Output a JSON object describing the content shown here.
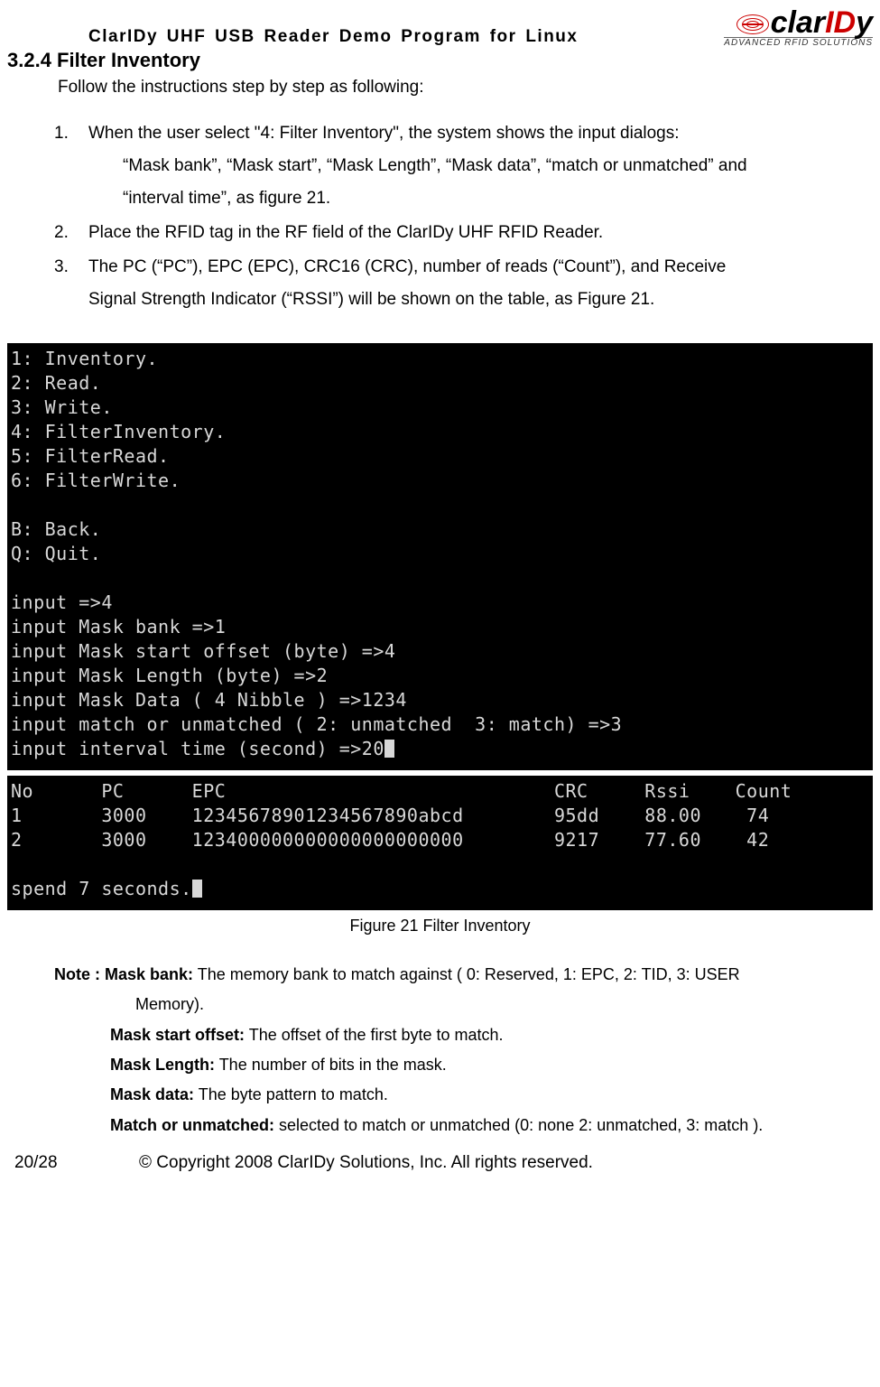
{
  "header": {
    "doc_title": "ClarIDy UHF USB Reader Demo Program for Linux",
    "logo_clar": "clar",
    "logo_id": "ID",
    "logo_y": "y",
    "logo_sub": "ADVANCED RFID SOLUTIONS"
  },
  "section": {
    "heading": "3.2.4 Filter Inventory",
    "intro": "Follow the instructions step by step as following:"
  },
  "steps": {
    "s1_num": "1.",
    "s1_line1": "When the user select \"4: Filter Inventory\", the system shows the input dialogs:",
    "s1_line2": "“Mask bank”, “Mask start”, “Mask Length”, “Mask data”, “match or unmatched” and",
    "s1_line3": "“interval time”, as figure 21.",
    "s2_num": "2.",
    "s2_line1": "Place the RFID tag in the RF field of the ClarIDy UHF RFID Reader.",
    "s3_num": "3.",
    "s3_line1": "The PC (“PC”), EPC (EPC), CRC16 (CRC), number of reads (“Count”), and Receive",
    "s3_line2": "Signal Strength Indicator (“RSSI”) will be shown on the table, as Figure 21."
  },
  "terminal1": "1: Inventory.\n2: Read.\n3: Write.\n4: FilterInventory.\n5: FilterRead.\n6: FilterWrite.\n\nB: Back.\nQ: Quit.\n\ninput =>4\ninput Mask bank =>1\ninput Mask start offset (byte) =>4\ninput Mask Length (byte) =>2\ninput Mask Data ( 4 Nibble ) =>1234\ninput match or unmatched ( 2: unmatched  3: match) =>3\ninput interval time (second) =>20",
  "chart_data": {
    "type": "table",
    "columns": [
      "No",
      "PC",
      "EPC",
      "CRC",
      "Rssi",
      "Count"
    ],
    "rows": [
      [
        "1",
        "3000",
        "12345678901234567890abcd",
        "95dd",
        "88.00",
        "74"
      ],
      [
        "2",
        "3000",
        "123400000000000000000000",
        "9217",
        "77.60",
        "42"
      ]
    ],
    "footer_line": "spend 7 seconds."
  },
  "terminal2": "No      PC      EPC                             CRC     Rssi    Count\n1       3000    12345678901234567890abcd        95dd    88.00    74\n2       3000    123400000000000000000000        9217    77.60    42\n\nspend 7 seconds.",
  "caption": "Figure 21 Filter Inventory",
  "notes": {
    "prefix": "Note : ",
    "n1_label": "Mask bank:",
    "n1_text": " The memory bank to match against ( 0: Reserved, 1: EPC, 2: TID, 3: USER",
    "n1_text2": "Memory).",
    "n2_label": "Mask start offset:",
    "n2_text": " The offset of the first byte to match.",
    "n3_label": "Mask Length:",
    "n3_text": " The number of bits in the mask.",
    "n4_label": "Mask data:",
    "n4_text": " The byte pattern to match.",
    "n5_label": "Match or unmatched:",
    "n5_text": " selected to match or unmatched (0: none 2: unmatched, 3: match )."
  },
  "footer": {
    "page": "20/28",
    "copyright": "© Copyright 2008 ClarIDy Solutions, Inc. All rights reserved."
  }
}
